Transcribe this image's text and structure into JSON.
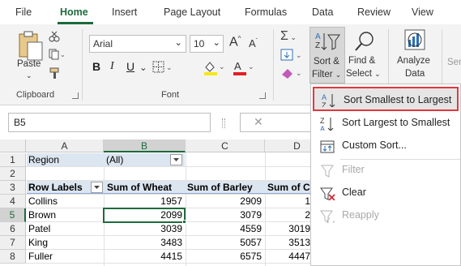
{
  "tabs": [
    "File",
    "Home",
    "Insert",
    "Page Layout",
    "Formulas",
    "Data",
    "Review",
    "View"
  ],
  "ribbon": {
    "clipboard": {
      "paste_label": "Paste",
      "group_label": "Clipboard"
    },
    "font": {
      "font_name": "Arial",
      "font_size": "10",
      "grow": "A",
      "shrink": "A",
      "bold": "B",
      "italic": "I",
      "underline": "U",
      "group_label": "Font"
    },
    "sort_filter": {
      "line1": "Sort &",
      "line2": "Filter"
    },
    "find_select": {
      "line1": "Find &",
      "line2": "Select"
    },
    "analyze": {
      "line1": "Analyze",
      "line2": "Data"
    },
    "sensitivity_partial": "Sen"
  },
  "formula_bar": {
    "name_box": "B5"
  },
  "sheet": {
    "columns": [
      "A",
      "B",
      "C",
      "D"
    ],
    "rows": [
      "1",
      "2",
      "3",
      "4",
      "5",
      "6",
      "7",
      "8"
    ],
    "r1": {
      "a": "Region",
      "b": "(All)"
    },
    "headers": {
      "a": "Row Labels",
      "b": "Sum of Wheat",
      "c": "Sum of Barley",
      "d": "Sum of C"
    },
    "data": [
      {
        "name": "Collins",
        "wheat": "1957",
        "barley": "2909",
        "d": "1"
      },
      {
        "name": "Brown",
        "wheat": "2099",
        "barley": "3079",
        "d": "2"
      },
      {
        "name": "Patel",
        "wheat": "3039",
        "barley": "4559",
        "d": "3019"
      },
      {
        "name": "King",
        "wheat": "3483",
        "barley": "5057",
        "d": "3513"
      },
      {
        "name": "Fuller",
        "wheat": "4415",
        "barley": "6575",
        "d": "4447"
      }
    ]
  },
  "sort_menu": {
    "items": [
      {
        "label": "Sort Smallest to Largest",
        "icon": "sort-ascending-icon",
        "highlight": true
      },
      {
        "label": "Sort Largest to Smallest",
        "icon": "sort-descending-icon"
      },
      {
        "label": "Custom Sort...",
        "icon": "custom-sort-icon"
      },
      {
        "label": "Filter",
        "icon": "filter-icon",
        "disabled": true
      },
      {
        "label": "Clear",
        "icon": "clear-filter-icon"
      },
      {
        "label": "Reapply",
        "icon": "reapply-icon",
        "disabled": true
      }
    ]
  },
  "colors": {
    "accent": "#1e6b3c",
    "highlight_border": "#e0393e",
    "menu_hover": "#e5e5e5"
  }
}
